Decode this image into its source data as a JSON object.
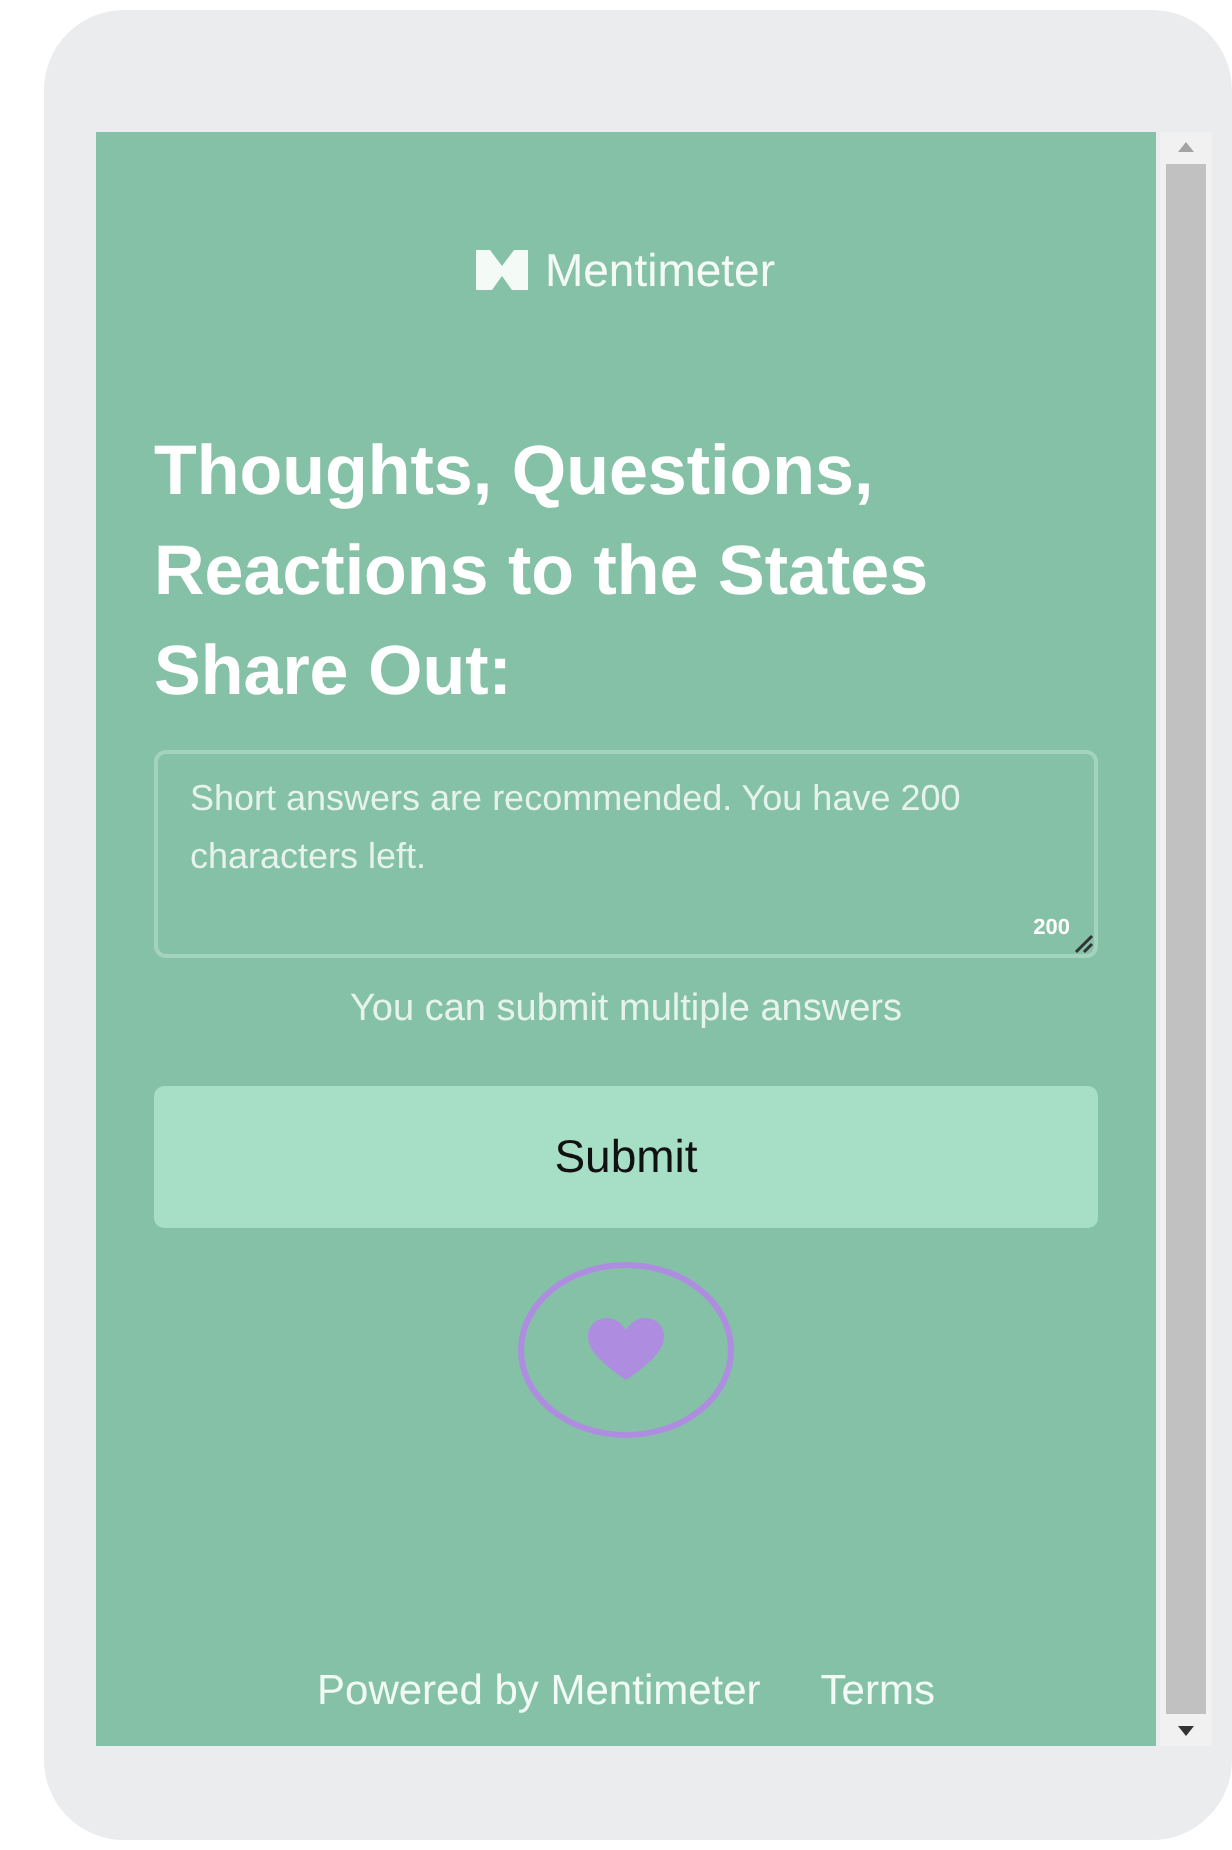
{
  "logo": {
    "text": "Mentimeter"
  },
  "question": {
    "title": "Thoughts, Questions, Reactions to the States Share Out:"
  },
  "answer": {
    "placeholder": "Short answers are recommended. You have 200 characters left.",
    "counter": "200"
  },
  "hint": "You can submit multiple answers",
  "submit_button": "Submit",
  "reaction": {
    "kind": "heart",
    "selected": false
  },
  "footer": [
    {
      "label": "Powered by Mentimeter"
    },
    {
      "label": "Terms"
    }
  ]
}
